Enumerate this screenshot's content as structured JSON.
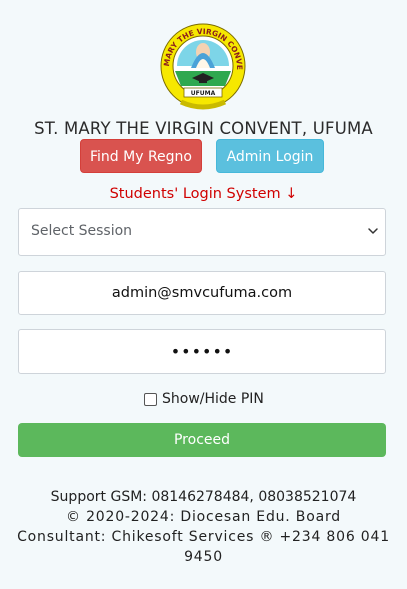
{
  "school": {
    "name": "ST. MARY THE VIRGIN CONVENT, UFUMA",
    "logo_text": "ST. MARY THE VIRGIN CONVENT",
    "logo_place": "UFUMA"
  },
  "buttons": {
    "find_regno": "Find My Regno",
    "admin_login": "Admin Login",
    "proceed": "Proceed"
  },
  "login": {
    "title": "Students' Login System ↓",
    "session_select": "Select Session",
    "email_value": "admin@smvcufuma.com",
    "pin_masked": "••••••",
    "show_hide_pin_label": "Show/Hide PIN"
  },
  "footer": {
    "support": "Support GSM: 08146278484, 08038521074",
    "copyright": "© 2020-2024: Diocesan Edu. Board",
    "consultant": "Consultant: Chikesoft Services ® +234 806 041",
    "consultant_tail": "9450"
  },
  "colors": {
    "find_regno_bg": "#d9534f",
    "admin_login_bg": "#5bc0de",
    "proceed_bg": "#5cb85c",
    "login_title": "#d00000"
  },
  "icons": {
    "logo": "school-crest",
    "select_chevron": "chevron-down-icon"
  }
}
